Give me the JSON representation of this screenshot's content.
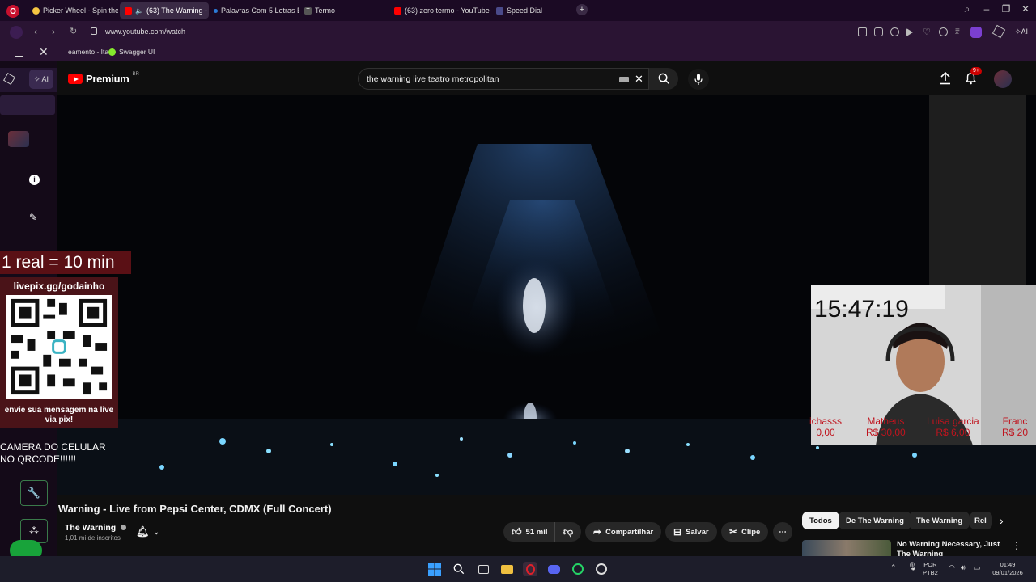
{
  "browser": {
    "tabs": [
      {
        "label": "Picker Wheel - Spin the W",
        "color": "#f5c542",
        "active": false
      },
      {
        "label": "(63) The Warning - Li",
        "color": "#ff0000",
        "active": true
      },
      {
        "label": "Palavras Com 5 Letras Em",
        "color": "#2b7bd6",
        "active": false
      },
      {
        "label": "Termo",
        "color": "#555555",
        "active": false
      },
      {
        "label": "(63) zero termo - YouTube",
        "color": "#ff0000",
        "active": false
      },
      {
        "label": "Speed Dial",
        "color": "#4a4a8a",
        "active": false
      }
    ],
    "url": "www.youtube.com/watch",
    "bookmarks": [
      {
        "label": "eamento - Itaú",
        "color": "#ff7a00"
      },
      {
        "label": "Swagger UI",
        "color": "#85ea2d"
      }
    ],
    "ai_label": "AI"
  },
  "youtube": {
    "logo_text": "Premium",
    "region": "BR",
    "search_value": "the warning live teatro metropolitan",
    "notification_count": "9+"
  },
  "overlay": {
    "rate_text": "1 real = 10 min",
    "qr_url": "livepix.gg/godainho",
    "qr_message": "envie sua mensagem na live via pix!",
    "camera_line1": "CAMERA DO CELULAR",
    "camera_line2": "NO QRCODE!!!!!!",
    "clock": "15:47:19",
    "donors": [
      {
        "name": "ichasss",
        "amount": "0,00"
      },
      {
        "name": "Matheus",
        "amount": "R$ 30,00"
      },
      {
        "name": "Luisa garcia",
        "amount": "R$ 6,00"
      },
      {
        "name": "Franc",
        "amount": "R$ 20"
      }
    ]
  },
  "video": {
    "title": "Warning - Live from Pepsi Center, CDMX (Full Concert)",
    "channel": "The Warning",
    "subscribers": "1,01 mi de inscritos",
    "likes": "51 mil",
    "share_label": "Compartilhar",
    "save_label": "Salvar",
    "clip_label": "Clipe"
  },
  "recommendations": {
    "chips": [
      "Todos",
      "De The Warning",
      "The Warning",
      "Rel"
    ],
    "first_title_line1": "No Warning Necessary, Just",
    "first_title_line2": "The Warning"
  },
  "taskbar": {
    "lang_line1": "POR",
    "lang_line2": "PTB2",
    "time": "01:49",
    "date": "09/01/2026"
  }
}
